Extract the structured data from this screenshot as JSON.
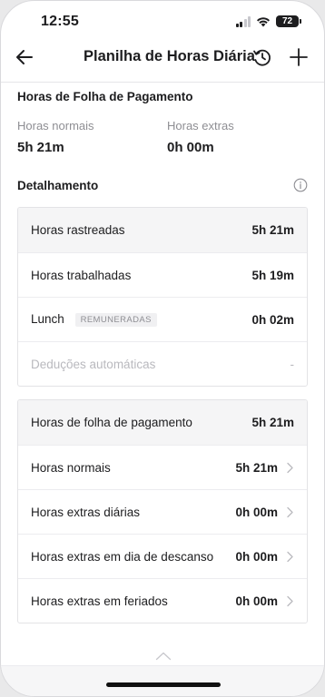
{
  "status_bar": {
    "time": "12:55",
    "battery": "72",
    "icons": [
      "signal-icon",
      "wifi-icon",
      "battery-icon"
    ]
  },
  "nav": {
    "title": "Planilha de Horas Diária",
    "back_icon": "arrow-left-icon",
    "history_icon": "history-icon",
    "add_icon": "plus-icon"
  },
  "payroll_summary": {
    "title": "Horas de Folha de Pagamento",
    "regular_label": "Horas normais",
    "regular_value": "5h 21m",
    "overtime_label": "Horas extras",
    "overtime_value": "0h 00m"
  },
  "breakdown": {
    "title": "Detalhamento",
    "info_icon": "info-icon",
    "tracked": {
      "label": "Horas rastreadas",
      "value": "5h 21m"
    },
    "worked": {
      "label": "Horas trabalhadas",
      "value": "5h 19m"
    },
    "lunch": {
      "label": "Lunch",
      "badge": "REMUNERADAS",
      "value": "0h 02m"
    },
    "auto_deductions": {
      "label": "Deduções automáticas",
      "value": "-"
    }
  },
  "payroll_detail": {
    "header": {
      "label": "Horas de folha de pagamento",
      "value": "5h 21m"
    },
    "rows": [
      {
        "label": "Horas normais",
        "value": "5h 21m"
      },
      {
        "label": "Horas extras diárias",
        "value": "0h 00m"
      },
      {
        "label": "Horas extras em dia de descanso",
        "value": "0h 00m"
      },
      {
        "label": "Horas extras em feriados",
        "value": "0h 00m"
      }
    ]
  },
  "colors": {
    "text": "#1d1d1f",
    "muted": "#8e8e93",
    "row_header_bg": "#f5f5f6",
    "border": "#e3e3e6"
  }
}
